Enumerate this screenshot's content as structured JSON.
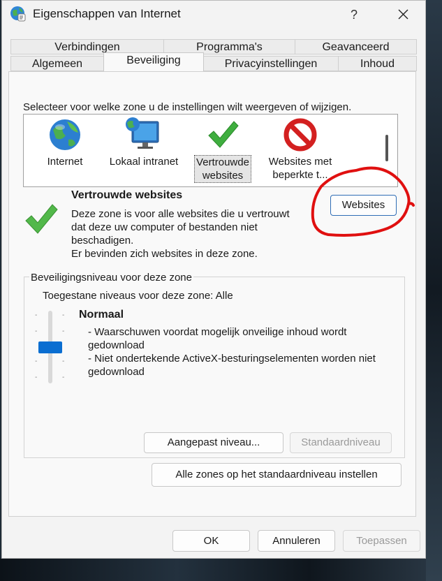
{
  "window": {
    "title": "Eigenschappen van Internet",
    "help_label": "?",
    "close_icon": "close-icon",
    "app_icon": "internet-options-icon"
  },
  "tabs": {
    "row1": [
      {
        "label": "Verbindingen"
      },
      {
        "label": "Programma's"
      },
      {
        "label": "Geavanceerd"
      }
    ],
    "row2": [
      {
        "label": "Algemeen"
      },
      {
        "label": "Beveiliging",
        "active": true
      },
      {
        "label": "Privacyinstellingen"
      },
      {
        "label": "Inhoud"
      }
    ]
  },
  "security": {
    "instruction": "Selecteer voor welke zone u de instellingen wilt weergeven of wijzigen.",
    "zones": [
      {
        "label1": "Internet",
        "label2": "",
        "icon": "globe-icon"
      },
      {
        "label1": "Lokaal intranet",
        "label2": "",
        "icon": "monitor-globe-icon"
      },
      {
        "label1": "Vertrouwde",
        "label2": "websites",
        "icon": "check-icon",
        "selected": true
      },
      {
        "label1": "Websites met",
        "label2": "beperkte t...",
        "icon": "prohibited-icon"
      }
    ],
    "selected_zone": {
      "title": "Vertrouwde websites",
      "desc_lines": [
        "Deze zone is voor alle websites die u vertrouwt",
        "dat deze uw computer of bestanden niet",
        "beschadigen.",
        "Er bevinden zich websites in deze zone."
      ],
      "websites_button": "Websites"
    },
    "level_group": {
      "legend": "Beveiligingsniveau voor deze zone",
      "allowed": "Toegestane niveaus voor deze zone: Alle",
      "level_name": "Normaal",
      "level_desc_lines": [
        "- Waarschuwen voordat mogelijk onveilige inhoud wordt",
        "gedownload",
        "- Niet ondertekende ActiveX-besturingselementen worden niet",
        "gedownload"
      ],
      "slider_level_fraction": 0.5,
      "custom_button": "Aangepast niveau...",
      "default_button": "Standaardniveau"
    },
    "reset_all_button": "Alle zones op het standaardniveau instellen"
  },
  "footer": {
    "ok": "OK",
    "cancel": "Annuleren",
    "apply": "Toepassen"
  },
  "colors": {
    "accent": "#0a6ed1",
    "annotation": "#e01010"
  }
}
